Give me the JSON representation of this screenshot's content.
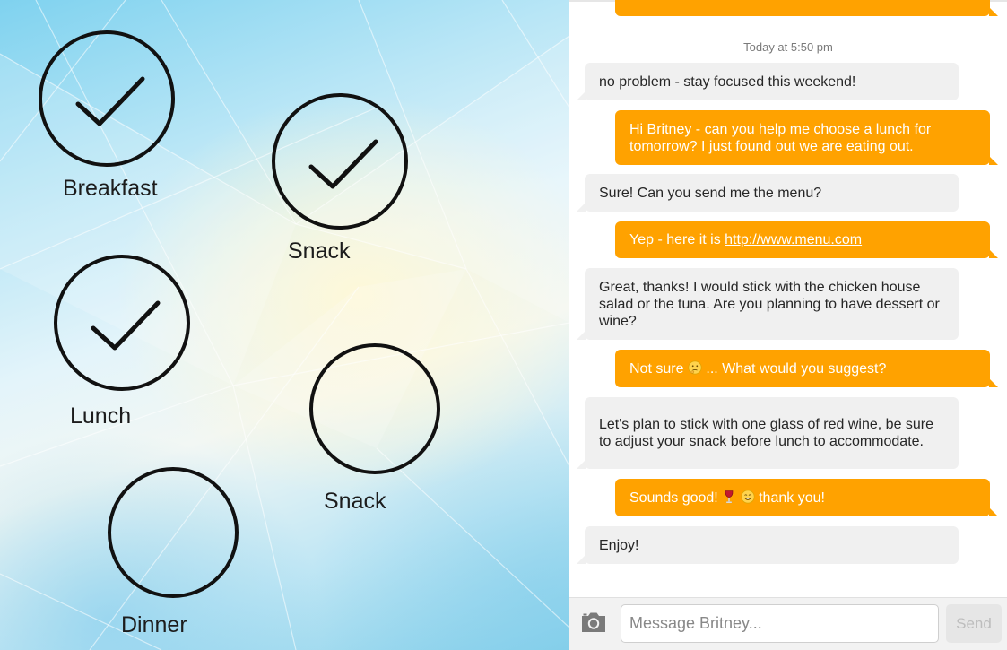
{
  "meal_tracker": {
    "items": [
      {
        "label": "Breakfast",
        "checked": true
      },
      {
        "label": "Snack",
        "checked": true
      },
      {
        "label": "Lunch",
        "checked": true
      },
      {
        "label": "Snack",
        "checked": false
      },
      {
        "label": "Dinner",
        "checked": false
      }
    ]
  },
  "chat": {
    "contact": "Britney",
    "timestamp": "Today at 5:50 pm",
    "messages": [
      {
        "from": "contact",
        "text": "no problem - stay focused this weekend!"
      },
      {
        "from": "me",
        "text": "Hi Britney - can you help me choose a lunch for tomorrow? I just found out we are eating out."
      },
      {
        "from": "contact",
        "text": "Sure! Can you send me the menu?"
      },
      {
        "from": "me",
        "text": "Yep - here it is ",
        "link": "http://www.menu.com"
      },
      {
        "from": "contact",
        "text": "Great, thanks! I would stick with the chicken house salad or the tuna. Are you planning to have dessert or wine?"
      },
      {
        "from": "me",
        "text_before": "Not sure ",
        "emoji": "thinking-face",
        "text_after": " ... What would you suggest?"
      },
      {
        "from": "contact",
        "text": "Let's plan to stick with one glass of red wine, be sure to adjust your snack before lunch to accommodate."
      },
      {
        "from": "me",
        "text_before": "Sounds good! ",
        "emojis": [
          "wine-glass",
          "smiling-face"
        ],
        "text_after": " thank you!"
      },
      {
        "from": "contact",
        "text": "Enjoy!"
      }
    ],
    "composer": {
      "placeholder": "Message Britney...",
      "send_label": "Send",
      "camera_icon": "camera-icon"
    },
    "colors": {
      "outgoing": "#ffa200",
      "incoming": "#f0f0f0"
    }
  }
}
